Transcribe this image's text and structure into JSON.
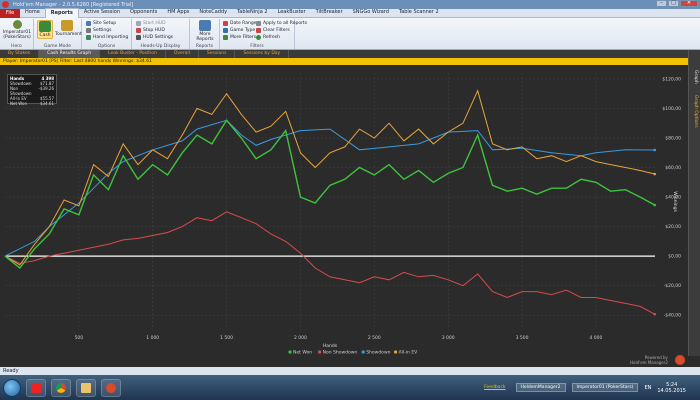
{
  "window": {
    "title": "Hold'em Manager - 2.0.5.6260 [Registered Trial]"
  },
  "menu": {
    "file_label": "File",
    "tabs": [
      "Home",
      "Reports",
      "Active Session",
      "Opponents",
      "HM Apps",
      "NoteCaddy",
      "TableNinja 2",
      "LeakBuster",
      "TiltBreaker",
      "SNGGo Wizard",
      "Table Scanner 2"
    ],
    "active_tab": "Reports"
  },
  "ribbon": {
    "hero": {
      "label": "Imperator01 (PokerStars)",
      "group": "Hero"
    },
    "game_mode": {
      "cash": "Cash",
      "tournament": "Tournament",
      "group": "Game Mode"
    },
    "options": {
      "items": [
        "Site Setup",
        "Settings",
        "Hand Importing"
      ],
      "group": "Options"
    },
    "hud": {
      "items": [
        "Start HUD",
        "Stop HUD",
        "HUD Settings"
      ],
      "group": "Heads-Up Display"
    },
    "reports": {
      "more": "More Reports",
      "group": "Reports"
    },
    "filters": {
      "items": [
        "Date Range",
        "Game Type",
        "More Filters"
      ],
      "right_items": [
        "Apply to all Reports",
        "Clear Filters",
        "Refresh"
      ],
      "group": "Filters"
    }
  },
  "report_tabs": [
    "By Stakes",
    "Cash Results Graph",
    "Leak Buster - Position",
    "Overall",
    "Sessions",
    "Sessions by Day"
  ],
  "active_report_tab": "Cash Results Graph",
  "filter_bar": "Player: Imperator01 [PS]  Filter: Last 4800 hands  Winnings: $34.61",
  "side_panel": {
    "graph": "Graph",
    "options": "Graph Options"
  },
  "stats": {
    "rows": [
      {
        "label": "Hands",
        "value": "4 398"
      },
      {
        "label": "Showdown",
        "value": "$71.87"
      },
      {
        "label": "Non Showdown",
        "value": "-$39.26"
      },
      {
        "label": "All-In EV",
        "value": "$55.57"
      },
      {
        "label": "Net Won",
        "value": "$34.61"
      }
    ]
  },
  "chart_data": {
    "type": "line",
    "xlabel": "Hands",
    "ylabel": "Winnings",
    "x_ticks": [
      500,
      1000,
      1500,
      2000,
      2500,
      3000,
      3500,
      4000
    ],
    "x_tick_labels": [
      "500",
      "1 000",
      "1 500",
      "2 000",
      "2 500",
      "3 000",
      "3 500",
      "4 000"
    ],
    "y_ticks": [
      -40,
      -20,
      0,
      20,
      40,
      60,
      80,
      100,
      120
    ],
    "y_tick_labels": [
      "-$40,00",
      "-$20,00",
      "$0,00",
      "$20,00",
      "$40,00",
      "$60,00",
      "$80,00",
      "$100,00",
      "$120,00"
    ],
    "xlim": [
      0,
      4400
    ],
    "ylim": [
      -50,
      124
    ],
    "grid": true,
    "legend_position": "bottom",
    "series": [
      {
        "name": "Net Won",
        "color": "#3cc43c",
        "x": [
          0,
          100,
          200,
          300,
          400,
          500,
          600,
          700,
          800,
          900,
          1000,
          1100,
          1200,
          1300,
          1400,
          1500,
          1600,
          1700,
          1800,
          1900,
          2000,
          2100,
          2200,
          2300,
          2400,
          2500,
          2600,
          2700,
          2800,
          2900,
          3000,
          3100,
          3200,
          3300,
          3400,
          3500,
          3600,
          3700,
          3800,
          3900,
          4000,
          4100,
          4200,
          4300,
          4398
        ],
        "y": [
          0,
          -8,
          5,
          15,
          32,
          28,
          55,
          45,
          68,
          52,
          62,
          55,
          70,
          82,
          76,
          92,
          80,
          66,
          72,
          85,
          40,
          36,
          48,
          52,
          60,
          55,
          62,
          52,
          58,
          50,
          56,
          60,
          82,
          48,
          44,
          46,
          42,
          46,
          46,
          52,
          50,
          44,
          45,
          40,
          34.6
        ]
      },
      {
        "name": "Non Showdown",
        "color": "#d94b4b",
        "x": [
          0,
          100,
          200,
          300,
          400,
          500,
          600,
          700,
          800,
          900,
          1000,
          1100,
          1200,
          1300,
          1400,
          1500,
          1600,
          1700,
          1800,
          1900,
          2000,
          2100,
          2200,
          2300,
          2400,
          2500,
          2600,
          2700,
          2800,
          2900,
          3000,
          3100,
          3200,
          3300,
          3400,
          3500,
          3600,
          3700,
          3800,
          3900,
          4000,
          4100,
          4200,
          4300,
          4398
        ],
        "y": [
          0,
          -5,
          -3,
          0,
          2,
          4,
          6,
          8,
          11,
          12,
          14,
          16,
          20,
          26,
          24,
          30,
          26,
          22,
          15,
          10,
          2,
          -8,
          -14,
          -16,
          -18,
          -14,
          -16,
          -11,
          -14,
          -13,
          -16,
          -20,
          -12,
          -24,
          -28,
          -24,
          -24,
          -26,
          -23,
          -28,
          -28,
          -30,
          -32,
          -34,
          -39.3
        ]
      },
      {
        "name": "Showdown",
        "color": "#3a9be0",
        "x": [
          0,
          200,
          300,
          500,
          600,
          700,
          800,
          1000,
          1200,
          1300,
          1500,
          1600,
          1700,
          1800,
          2000,
          2200,
          2400,
          2600,
          2800,
          3000,
          3200,
          3300,
          3500,
          3700,
          3900,
          4000,
          4200,
          4398
        ],
        "y": [
          0,
          10,
          20,
          36,
          46,
          56,
          64,
          72,
          78,
          86,
          92,
          82,
          75,
          79,
          85,
          86,
          72,
          74,
          76,
          84,
          85,
          72,
          73,
          70,
          68,
          70,
          72,
          71.9
        ]
      },
      {
        "name": "All-in EV",
        "color": "#e8a33a",
        "x": [
          0,
          100,
          200,
          300,
          400,
          500,
          600,
          700,
          800,
          900,
          1000,
          1100,
          1200,
          1300,
          1400,
          1500,
          1600,
          1700,
          1800,
          1900,
          2000,
          2100,
          2200,
          2300,
          2400,
          2500,
          2600,
          2700,
          2800,
          2900,
          3000,
          3100,
          3200,
          3300,
          3400,
          3500,
          3600,
          3700,
          3800,
          3900,
          4000,
          4100,
          4200,
          4300,
          4398
        ],
        "y": [
          0,
          -6,
          8,
          20,
          38,
          34,
          62,
          54,
          76,
          62,
          72,
          66,
          82,
          100,
          96,
          110,
          96,
          84,
          88,
          98,
          70,
          60,
          70,
          74,
          86,
          80,
          90,
          78,
          86,
          76,
          84,
          90,
          112,
          76,
          72,
          74,
          66,
          68,
          64,
          68,
          64,
          62,
          60,
          58,
          55.6
        ]
      }
    ]
  },
  "branding": {
    "line1": "Powered by",
    "line2": "Hold'em Manager2"
  },
  "status": {
    "text": "Ready"
  },
  "taskbar": {
    "feedback": "Feedback",
    "holdem_manager": "HoldemManager2",
    "player_pill": "Imperator01 (PokerStars)",
    "lang": "EN",
    "time": "5:24",
    "date": "14.05.2015"
  },
  "colors": {
    "accent": "#e8a33a",
    "filter_bar": "#f2c200",
    "chart_bg": "#2b2b2b"
  }
}
